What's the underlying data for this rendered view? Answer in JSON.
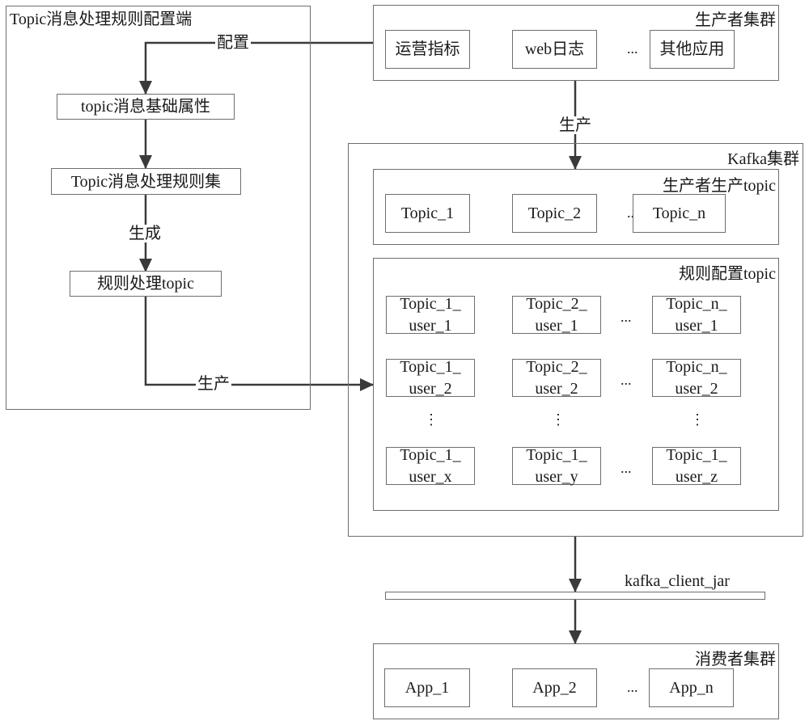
{
  "config_side": {
    "title": "Topic消息处理规则配置端",
    "nodes": {
      "basic_attrs": "topic消息基础属性",
      "rule_set": "Topic消息处理规则集",
      "rule_topic": "规则处理topic"
    },
    "edges": {
      "config": "配置",
      "generate": "生成",
      "produce": "生产"
    }
  },
  "producer_cluster": {
    "title": "生产者集群",
    "apps": [
      "运营指标",
      "web日志",
      "其他应用"
    ],
    "ellipsis": "...",
    "edge_produce": "生产"
  },
  "kafka_cluster": {
    "title": "Kafka集群",
    "producer_topics": {
      "title": "生产者生产topic",
      "topics": [
        "Topic_1",
        "Topic_2",
        "Topic_n"
      ],
      "ellipsis": "..."
    },
    "rule_topics": {
      "title": "规则配置topic",
      "rows": [
        [
          [
            "Topic_1_",
            "user_1"
          ],
          [
            "Topic_2_",
            "user_1"
          ],
          [
            "Topic_n_",
            "user_1"
          ]
        ],
        [
          [
            "Topic_1_",
            "user_2"
          ],
          [
            "Topic_2_",
            "user_2"
          ],
          [
            "Topic_n_",
            "user_2"
          ]
        ],
        [
          [
            "Topic_1_",
            "user_x"
          ],
          [
            "Topic_1_",
            "user_y"
          ],
          [
            "Topic_1_",
            "user_z"
          ]
        ]
      ],
      "ellipsis": "...",
      "vertical_ellipsis": "⋮"
    }
  },
  "client_jar": {
    "label": "kafka_client_jar"
  },
  "consumer_cluster": {
    "title": "消费者集群",
    "apps": [
      "App_1",
      "App_2",
      "App_n"
    ],
    "ellipsis": "..."
  }
}
